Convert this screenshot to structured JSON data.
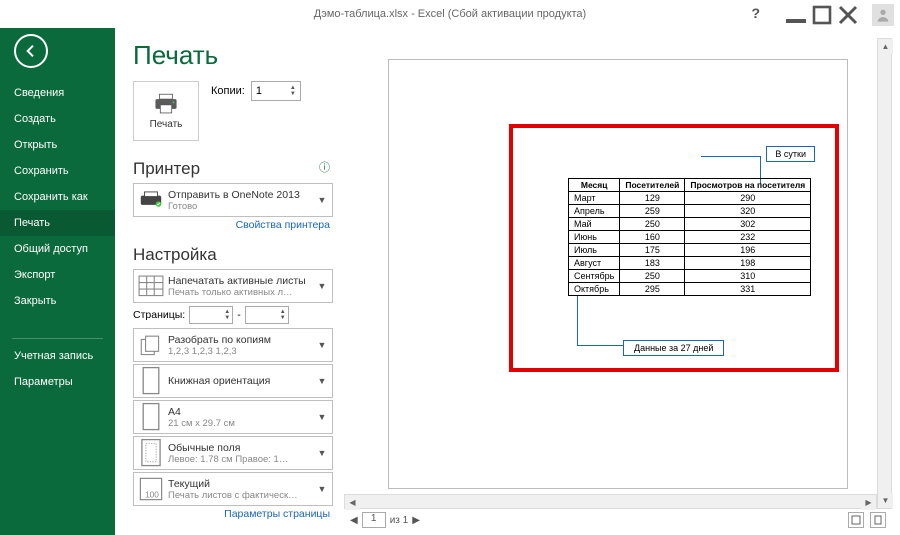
{
  "window": {
    "title": "Дэмо-таблица.xlsx - Excel (Сбой активации продукта)"
  },
  "sidebar": {
    "items": [
      {
        "label": "Сведения"
      },
      {
        "label": "Создать"
      },
      {
        "label": "Открыть"
      },
      {
        "label": "Сохранить"
      },
      {
        "label": "Сохранить как"
      },
      {
        "label": "Печать",
        "active": true
      },
      {
        "label": "Общий доступ"
      },
      {
        "label": "Экспорт"
      },
      {
        "label": "Закрыть"
      }
    ],
    "bottom": [
      {
        "label": "Учетная запись"
      },
      {
        "label": "Параметры"
      }
    ]
  },
  "print": {
    "heading": "Печать",
    "button": "Печать",
    "copies_label": "Копии:",
    "copies_value": "1",
    "printer_heading": "Принтер",
    "printer_name": "Отправить в OneNote 2013",
    "printer_status": "Готово",
    "printer_props": "Свойства принтера",
    "settings_heading": "Настройка",
    "opt_active_l1": "Напечатать активные листы",
    "opt_active_l2": "Печать только активных л…",
    "pages_label": "Страницы:",
    "pages_sep": "-",
    "opt_collate_l1": "Разобрать по копиям",
    "opt_collate_l2": "1,2,3   1,2,3   1,2,3",
    "opt_orient_l1": "Книжная ориентация",
    "opt_size_l1": "A4",
    "opt_size_l2": "21 см x 29.7 см",
    "opt_margins_l1": "Обычные поля",
    "opt_margins_l2": "Левое: 1.78 см  Правое: 1…",
    "opt_scale_l1": "Текущий",
    "opt_scale_l2": "Печать листов с фактическ…",
    "page_setup": "Параметры страницы"
  },
  "preview": {
    "pagenav_value": "1",
    "pagenav_of": "из 1",
    "callout_daily": "В сутки",
    "callout_27": "Данные за 27 дней",
    "table": {
      "headers": [
        "Месяц",
        "Посетителей",
        "Просмотров на посетителя"
      ],
      "rows": [
        [
          "Март",
          "129",
          "290"
        ],
        [
          "Апрель",
          "259",
          "320"
        ],
        [
          "Май",
          "250",
          "302"
        ],
        [
          "Июнь",
          "160",
          "232"
        ],
        [
          "Июль",
          "175",
          "196"
        ],
        [
          "Август",
          "183",
          "198"
        ],
        [
          "Сентябрь",
          "250",
          "310"
        ],
        [
          "Октябрь",
          "295",
          "331"
        ]
      ]
    }
  }
}
